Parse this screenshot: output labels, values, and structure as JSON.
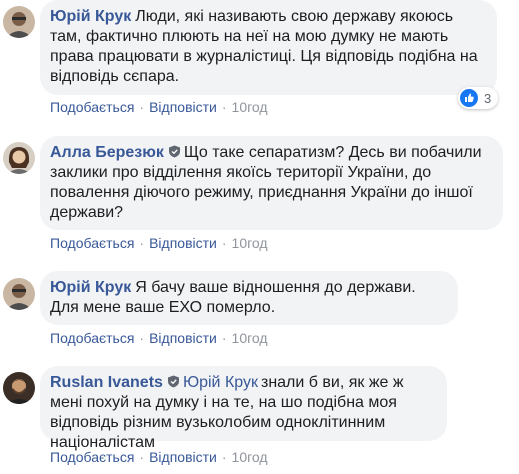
{
  "colors": {
    "link": "#385898",
    "bubble": "#f2f3f5",
    "meta": "#90949c",
    "like": "#1877f2"
  },
  "actions": {
    "like_label": "Подобається",
    "reply_label": "Відповісти",
    "separator": "·"
  },
  "comments": [
    {
      "author": "Юрій Крук",
      "text": "Люди, які називають свою державу якоюсь там, фактично плюють на неї на мою думку не мають права працювати в журналістиці. Ця відповідь подібна на відповідь сєпара.",
      "time": "10год",
      "reaction_count": "3",
      "reaction_icon": "thumbs-up-icon"
    },
    {
      "author": "Алла Березюк",
      "text": "Що таке сепаратизм? Десь ви побачили заклики про відділення якоїсь території України, до повалення діючого режиму, приєднання України до іншої держави?",
      "time": "10год"
    },
    {
      "author": "Юрій Крук",
      "text": "Я бачу ваше відношення до держави. Для мене ваше ЕХО померло.",
      "time": "10год"
    },
    {
      "author": "Ruslan Ivanets",
      "mention": "Юрій Крук",
      "text": "знали б ви, як же ж мені похуй на думку і на те, на шо подібна моя відповідь різним вузьколобим одноклітинним націоналістам",
      "time": "10год"
    }
  ]
}
